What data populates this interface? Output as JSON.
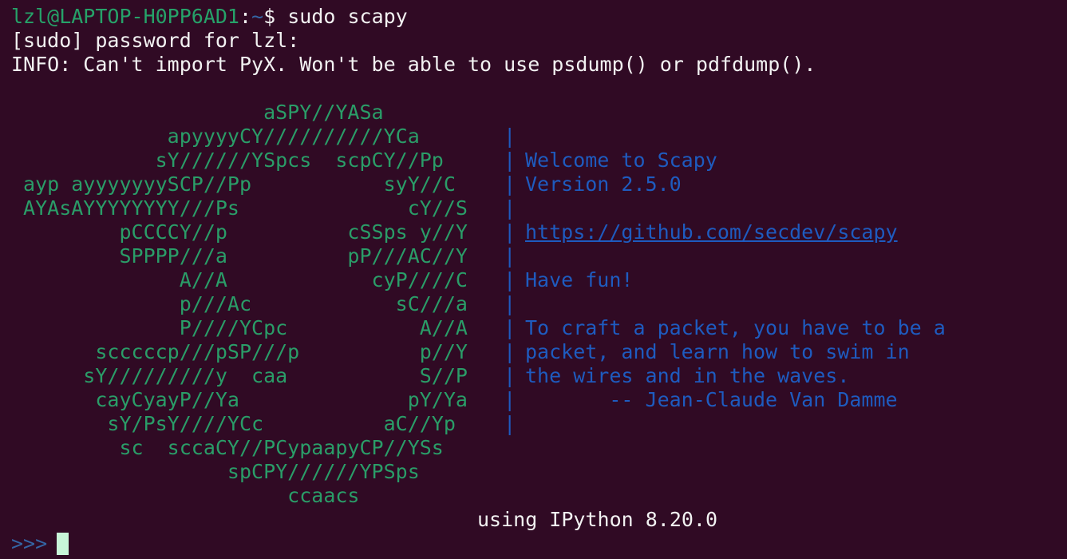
{
  "terminal": {
    "prompt": {
      "user_host": "lzl@LAPTOP-H0PP6AD1",
      "colon": ":",
      "path": "~",
      "dollar": "$",
      "command": " sudo scapy"
    },
    "sudo_line": "[sudo] password for lzl:",
    "info_line": "INFO: Can't import PyX. Won't be able to use psdump() or pdfdump().",
    "art_lines": [
      "                     aSPY//YASa",
      "             apyyyyCY//////////YCa       |",
      "            sY//////YSpcs  scpCY//Pp     | ",
      " ayp ayyyyyyySCP//Pp           syY//C    | ",
      " AYAsAYYYYYYYY///Ps              cY//S   |",
      "         pCCCCY//p          cSSps y//Y   | ",
      "         SPPPP///a          pP///AC//Y   |",
      "              A//A            cyP////C   | ",
      "              p///Ac            sC///a   |",
      "              P////YCpc           A//A   | ",
      "       scccccp///pSP///p          p//Y   | ",
      "      sY/////////y  caa           S//P   | ",
      "       cayCyayP//Ya              pY/Ya   | ",
      "        sY/PsY////YCc          aC//Yp    | ",
      "         sc  sccaCY//PCypaapyCP//YSs",
      "                  spCPY//////YPSps",
      "                       ccaacs"
    ],
    "banner_lines": [
      "",
      "Welcome to Scapy",
      "Version 2.5.0",
      "",
      "https://github.com/secdev/scapy",
      "",
      "Have fun!",
      "",
      "To craft a packet, you have to be a",
      "packet, and learn how to swim in",
      "the wires and in the waves.",
      "       -- Jean-Claude Van Damme",
      ""
    ],
    "ipython_line": "using IPython 8.20.0",
    "input_prompt": ">>>"
  }
}
